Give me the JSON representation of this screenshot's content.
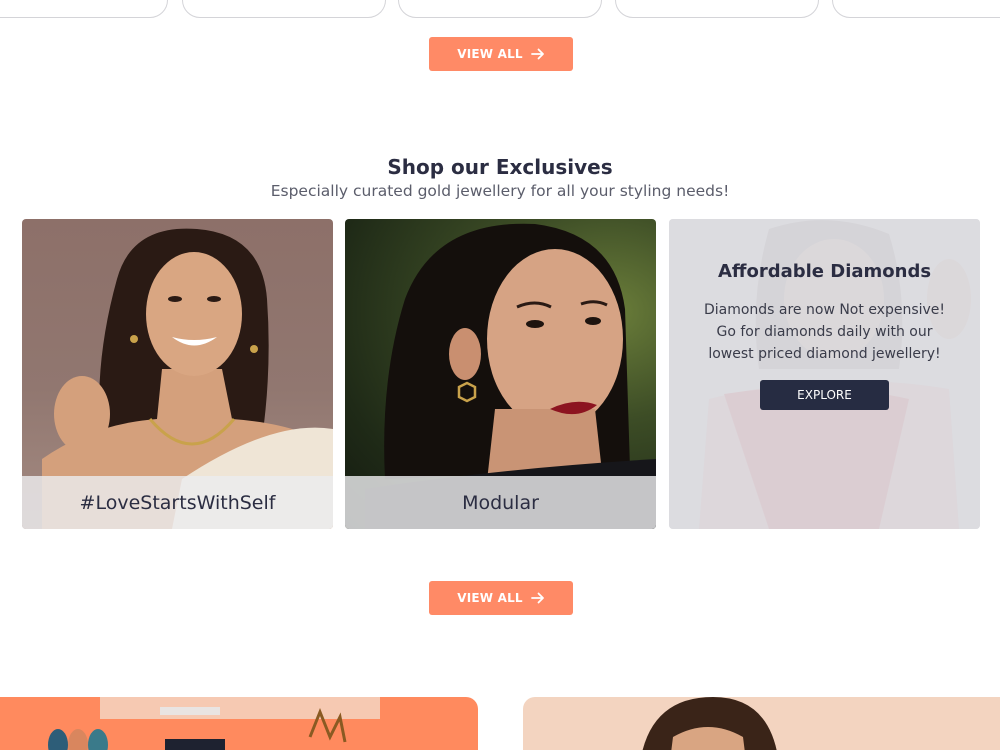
{
  "top_row": {
    "cards": [
      "",
      "",
      "",
      "",
      ""
    ]
  },
  "view_all_top": {
    "label": "VIEW ALL"
  },
  "exclusives": {
    "title": "Shop our Exclusives",
    "subtitle": "Especially curated gold jewellery for all your styling needs!",
    "tiles": [
      {
        "caption": "#LoveStartsWithSelf"
      },
      {
        "caption": "Modular"
      }
    ],
    "diamonds": {
      "title": "Affordable Diamonds",
      "line1": "Diamonds are now Not expensive!",
      "line2": "Go for diamonds daily with our",
      "line3": "lowest priced diamond jewellery!",
      "button": "EXPLORE"
    }
  },
  "view_all_bottom": {
    "label": "VIEW ALL"
  },
  "colors": {
    "accent": "#ff8a66",
    "dark_button": "#262c42",
    "heading": "#2b2d42",
    "banner_left": "#ff8a5e",
    "banner_right": "#f3d4c0"
  }
}
